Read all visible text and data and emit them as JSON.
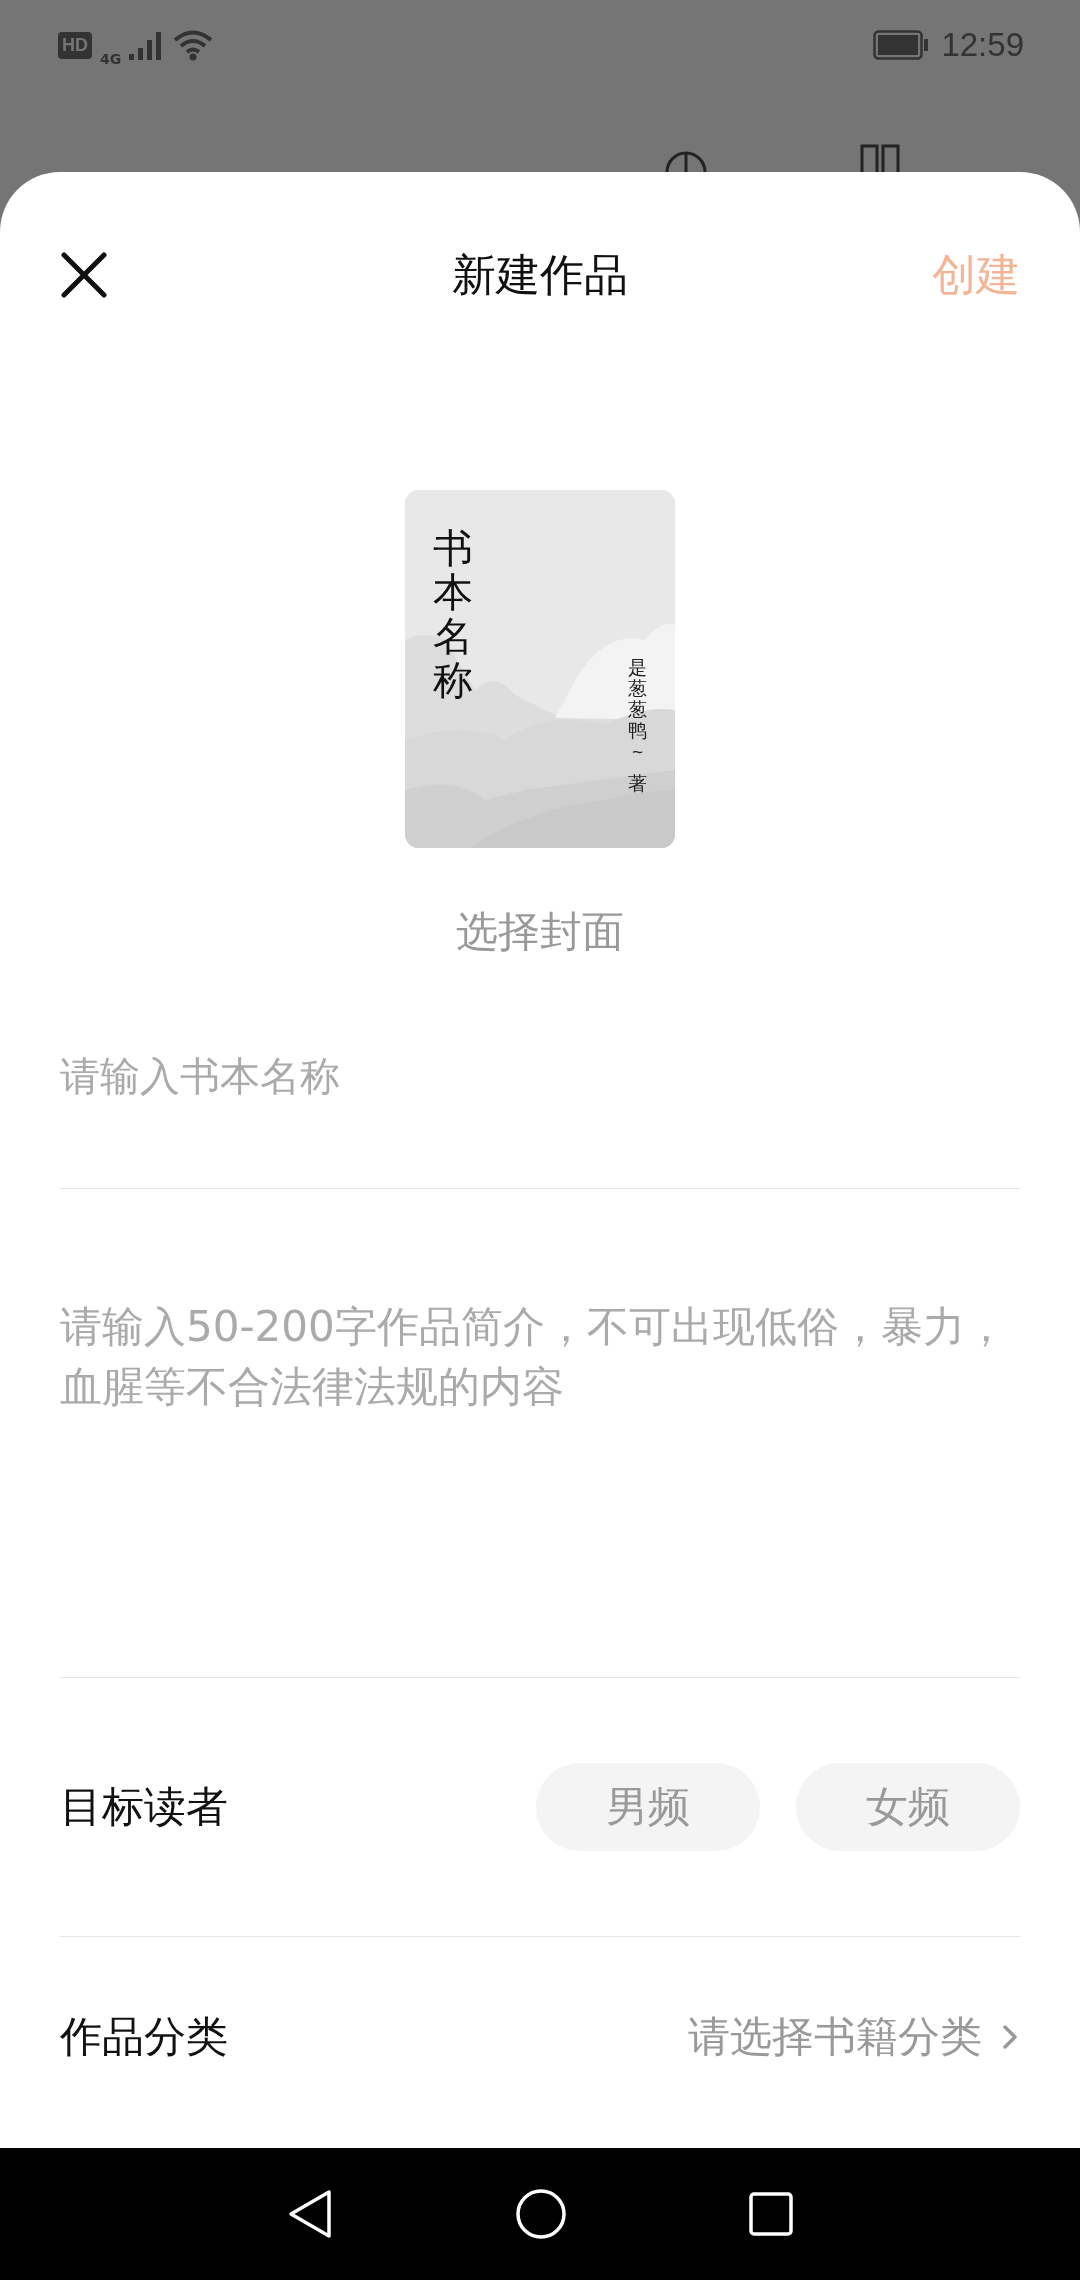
{
  "status_bar": {
    "hd": "HD",
    "time": "12:59",
    "network": "4G"
  },
  "sheet": {
    "title": "新建作品",
    "create": "创建"
  },
  "cover": {
    "title": "书本名称",
    "author": "是葱葱鸭~",
    "author_suffix": "著",
    "caption": "选择封面"
  },
  "name_field": {
    "placeholder": "请输入书本名称"
  },
  "intro_field": {
    "placeholder": "请输入50-200字作品简介，不可出现低俗，暴力，血腥等不合法律法规的内容"
  },
  "target_reader": {
    "label": "目标读者",
    "options": [
      {
        "label": "男频",
        "selected": false
      },
      {
        "label": "女频",
        "selected": false
      }
    ]
  },
  "category": {
    "label": "作品分类",
    "placeholder": "请选择书籍分类"
  }
}
